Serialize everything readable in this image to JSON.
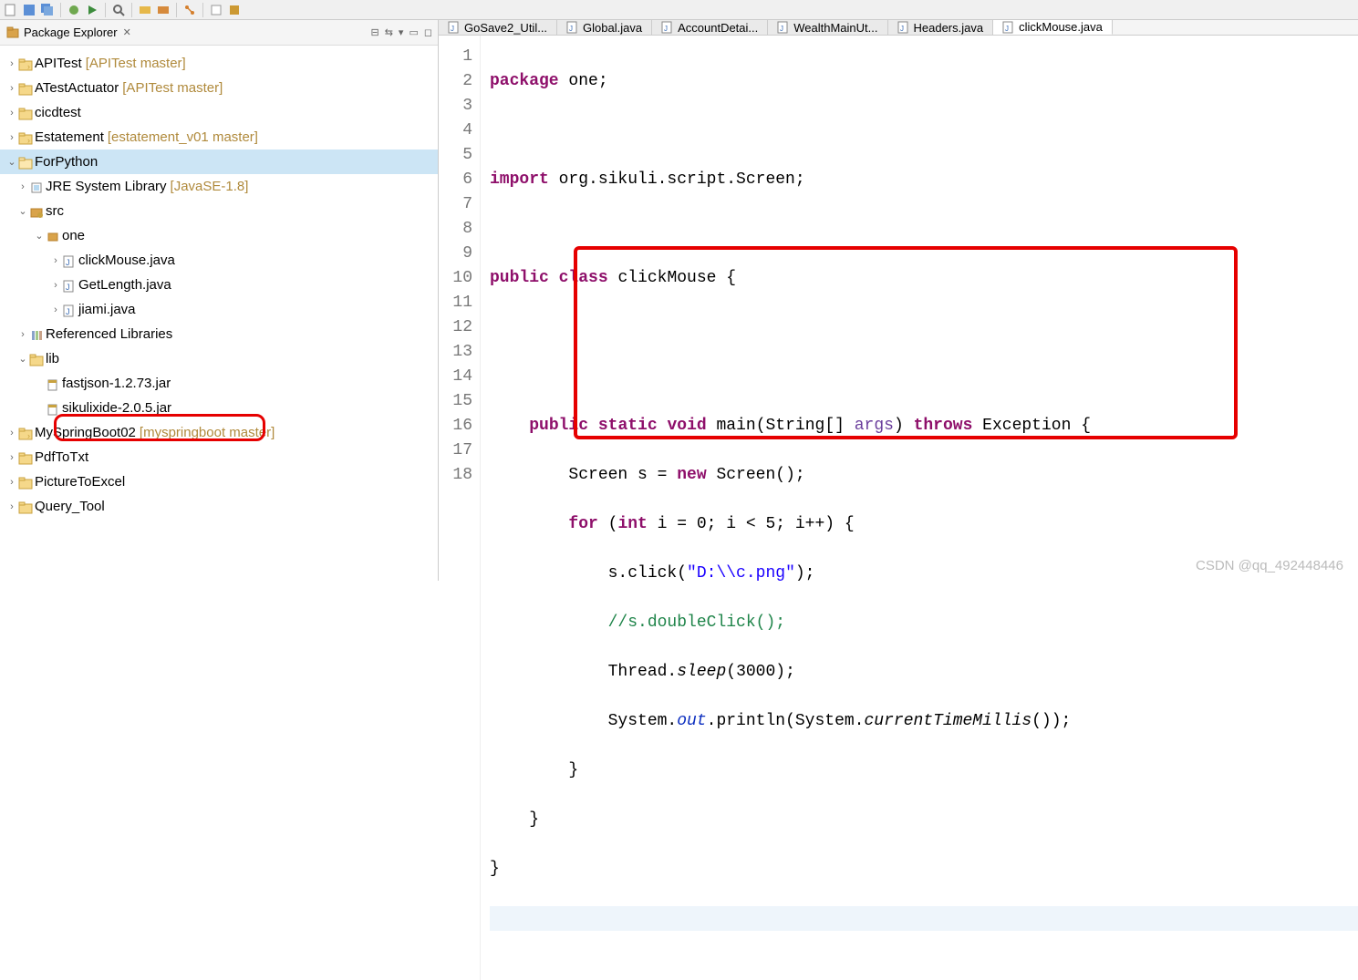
{
  "toolbar_icons": [
    "new",
    "save",
    "save-all",
    "debug",
    "run",
    "file",
    "search",
    "undo",
    "redo",
    "cut",
    "copy",
    "paste",
    "term",
    "ext",
    "step",
    "step-in",
    "step-out",
    "resume",
    "stop",
    "launch",
    "refresh",
    "build",
    "git",
    "task",
    "prob",
    "cons"
  ],
  "explorer": {
    "title": "Package Explorer",
    "actions": [
      "collapse",
      "link",
      "menu",
      "min",
      "max"
    ]
  },
  "tree": [
    {
      "depth": 0,
      "arrow": "›",
      "icon": "project-git",
      "label": "APITest",
      "suffix": "[APITest master]"
    },
    {
      "depth": 0,
      "arrow": "›",
      "icon": "project",
      "label": "ATestActuator",
      "suffix": "[APITest master]"
    },
    {
      "depth": 0,
      "arrow": "›",
      "icon": "project",
      "label": "cicdtest",
      "suffix": ""
    },
    {
      "depth": 0,
      "arrow": "›",
      "icon": "project-git",
      "label": "Estatement",
      "suffix": "[estatement_v01 master]"
    },
    {
      "depth": 0,
      "arrow": "⌄",
      "icon": "project-open",
      "label": "ForPython",
      "suffix": "",
      "selected": true
    },
    {
      "depth": 1,
      "arrow": "›",
      "icon": "jre",
      "label": "JRE System Library",
      "suffix": "[JavaSE-1.8]"
    },
    {
      "depth": 1,
      "arrow": "⌄",
      "icon": "src",
      "label": "src",
      "suffix": ""
    },
    {
      "depth": 2,
      "arrow": "⌄",
      "icon": "package",
      "label": "one",
      "suffix": ""
    },
    {
      "depth": 3,
      "arrow": "›",
      "icon": "java",
      "label": "clickMouse.java",
      "suffix": ""
    },
    {
      "depth": 3,
      "arrow": "›",
      "icon": "java",
      "label": "GetLength.java",
      "suffix": ""
    },
    {
      "depth": 3,
      "arrow": "›",
      "icon": "java",
      "label": "jiami.java",
      "suffix": ""
    },
    {
      "depth": 1,
      "arrow": "›",
      "icon": "lib",
      "label": "Referenced Libraries",
      "suffix": ""
    },
    {
      "depth": 1,
      "arrow": "⌄",
      "icon": "folder",
      "label": "lib",
      "suffix": ""
    },
    {
      "depth": 2,
      "arrow": "",
      "icon": "jar",
      "label": "fastjson-1.2.73.jar",
      "suffix": ""
    },
    {
      "depth": 2,
      "arrow": "",
      "icon": "jar",
      "label": "sikulixide-2.0.5.jar",
      "suffix": ""
    },
    {
      "depth": 0,
      "arrow": "›",
      "icon": "project-git",
      "label": "MySpringBoot02",
      "suffix": "[myspringboot master]"
    },
    {
      "depth": 0,
      "arrow": "›",
      "icon": "project",
      "label": "PdfToTxt",
      "suffix": ""
    },
    {
      "depth": 0,
      "arrow": "›",
      "icon": "project",
      "label": "PictureToExcel",
      "suffix": ""
    },
    {
      "depth": 0,
      "arrow": "›",
      "icon": "project",
      "label": "Query_Tool",
      "suffix": ""
    }
  ],
  "tabs": [
    {
      "label": "GoSave2_Util...",
      "active": false
    },
    {
      "label": "Global.java",
      "active": false
    },
    {
      "label": "AccountDetai...",
      "active": false
    },
    {
      "label": "WealthMainUt...",
      "active": false
    },
    {
      "label": "Headers.java",
      "active": false
    },
    {
      "label": "clickMouse.java",
      "active": true
    }
  ],
  "code": {
    "lines": [
      1,
      2,
      3,
      4,
      5,
      6,
      7,
      8,
      9,
      10,
      11,
      12,
      13,
      14,
      15,
      16,
      17,
      18
    ],
    "l1_kw1": "package",
    "l1_t": " one;",
    "l3_kw1": "import",
    "l3_t": " org.sikuli.script.Screen;",
    "l5_kw1": "public",
    "l5_kw2": "class",
    "l5_t": " clickMouse {",
    "l8_kw1": "public",
    "l8_kw2": "static",
    "l8_kw3": "void",
    "l8_m": " main",
    "l8_t1": "(String[] ",
    "l8_a": "args",
    "l8_t2": ") ",
    "l8_kw4": "throws",
    "l8_t3": " Exception {",
    "l9_t1": "Screen s = ",
    "l9_kw1": "new",
    "l9_t2": " Screen();",
    "l10_kw1": "for",
    "l10_t1": " (",
    "l10_kw2": "int",
    "l10_t2": " i = 0; i < 5; i++) {",
    "l11_t1": "s.click(",
    "l11_s": "\"D:\\\\c.png\"",
    "l11_t2": ");",
    "l12_c": "//s.doubleClick();",
    "l13_t1": "Thread.",
    "l13_m": "sleep",
    "l13_t2": "(3000);",
    "l14_t1": "System.",
    "l14_f": "out",
    "l14_t2": ".println(System.",
    "l14_m": "currentTimeMillis",
    "l14_t3": "());",
    "l15_t": "}",
    "l16_t": "}",
    "l17_t": "}"
  },
  "watermark": "CSDN @qq_492448446"
}
